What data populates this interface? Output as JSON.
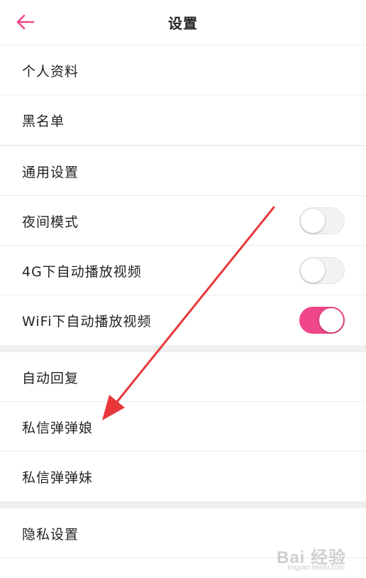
{
  "header": {
    "title": "设置",
    "back_icon": "arrow-left-icon",
    "accent": "#f0468a"
  },
  "sections": [
    {
      "items": [
        {
          "label": "个人资料"
        },
        {
          "label": "黑名单"
        }
      ]
    },
    {
      "items": [
        {
          "label": "通用设置"
        },
        {
          "label": "夜间模式",
          "toggle": false
        },
        {
          "label": "4G下自动播放视频",
          "toggle": false
        },
        {
          "label": "WiFi下自动播放视频",
          "toggle": true
        }
      ]
    },
    {
      "items": [
        {
          "label": "自动回复"
        },
        {
          "label": "私信弹弹娘"
        },
        {
          "label": "私信弹弹妹"
        }
      ]
    },
    {
      "items": [
        {
          "label": "隐私设置"
        }
      ]
    }
  ],
  "annotation": {
    "color": "#e8373b",
    "points_to": "私信弹弹娘"
  },
  "watermark": {
    "text": "Bai 经验",
    "sub": "jingyan.baidu.com"
  }
}
